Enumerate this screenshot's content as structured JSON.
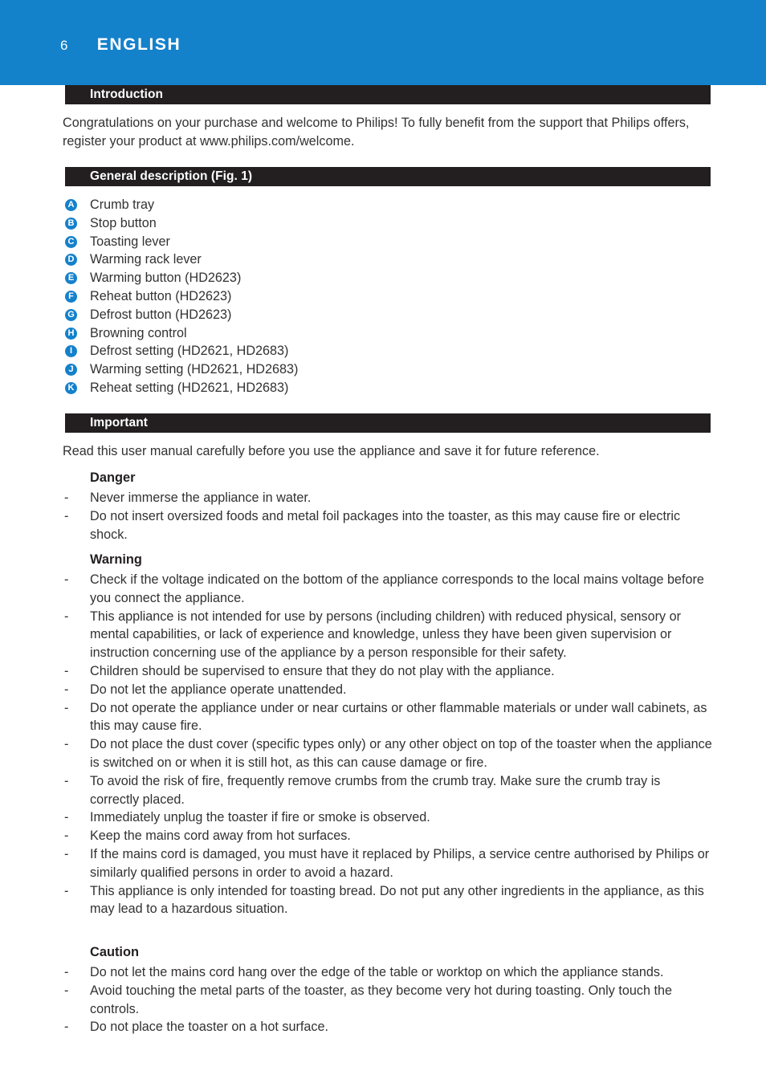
{
  "page": {
    "number": "6",
    "language": "ENGLISH",
    "band_color": "#1481cb",
    "bar_color": "#231f20"
  },
  "sections": {
    "introduction": {
      "heading": "Introduction",
      "paragraph": "Congratulations on your purchase and welcome to Philips! To fully benefit from the support that Philips offers, register your product at www.philips.com/welcome."
    },
    "general_description": {
      "heading": "General description (Fig. 1)",
      "items": [
        {
          "letter": "A",
          "label": "Crumb tray"
        },
        {
          "letter": "B",
          "label": "Stop button"
        },
        {
          "letter": "C",
          "label": "Toasting lever"
        },
        {
          "letter": "D",
          "label": "Warming rack lever"
        },
        {
          "letter": "E",
          "label": "Warming button (HD2623)"
        },
        {
          "letter": "F",
          "label": "Reheat button (HD2623)"
        },
        {
          "letter": "G",
          "label": "Defrost button (HD2623)"
        },
        {
          "letter": "H",
          "label": "Browning control"
        },
        {
          "letter": "I",
          "label": "Defrost setting (HD2621, HD2683)"
        },
        {
          "letter": "J",
          "label": "Warming setting (HD2621, HD2683)"
        },
        {
          "letter": "K",
          "label": "Reheat setting (HD2621, HD2683)"
        }
      ]
    },
    "important": {
      "heading": "Important",
      "intro": "Read this user manual carefully before you use the appliance and save it for future reference.",
      "danger": {
        "title": "Danger",
        "bullets": [
          "Never immerse the appliance in water.",
          "Do not insert oversized foods and metal foil packages into the toaster, as this may cause fire or electric shock."
        ]
      },
      "warning": {
        "title": "Warning",
        "bullets": [
          "Check if the voltage indicated on the bottom of the appliance corresponds to the local mains voltage before you connect the appliance.",
          "This appliance is not intended for use by persons (including children) with reduced physical, sensory or mental capabilities, or lack of experience and knowledge, unless they have been given supervision or instruction concerning use of the appliance by a person responsible for their safety.",
          "Children should be supervised to ensure that they do not play with the appliance.",
          "Do not let the appliance operate unattended.",
          "Do not operate the appliance under or near curtains or other flammable materials or under wall cabinets, as this may cause fire.",
          "Do not place the dust cover (specific types only) or any other object on top of the toaster when the appliance is switched on or when it is still hot, as this can cause damage or fire.",
          "To avoid the risk of fire, frequently remove crumbs from the crumb tray. Make sure the crumb tray is correctly placed.",
          "Immediately unplug the toaster if fire or smoke is observed.",
          "Keep the mains cord away from hot surfaces.",
          "If the mains cord is damaged, you must have it replaced by Philips, a service centre authorised by Philips or similarly qualified persons in order to avoid a hazard.",
          "This appliance is only intended for toasting bread. Do not put any other ingredients in the appliance, as this may lead to a hazardous situation."
        ]
      },
      "caution": {
        "title": "Caution",
        "bullets": [
          "Do not let the mains cord hang over the edge of the table or worktop on which the appliance stands.",
          "Avoid touching the metal parts of the toaster, as they become very hot during toasting. Only touch the controls.",
          "Do not place the toaster on a hot surface."
        ]
      }
    }
  },
  "bullet_marker": "-"
}
